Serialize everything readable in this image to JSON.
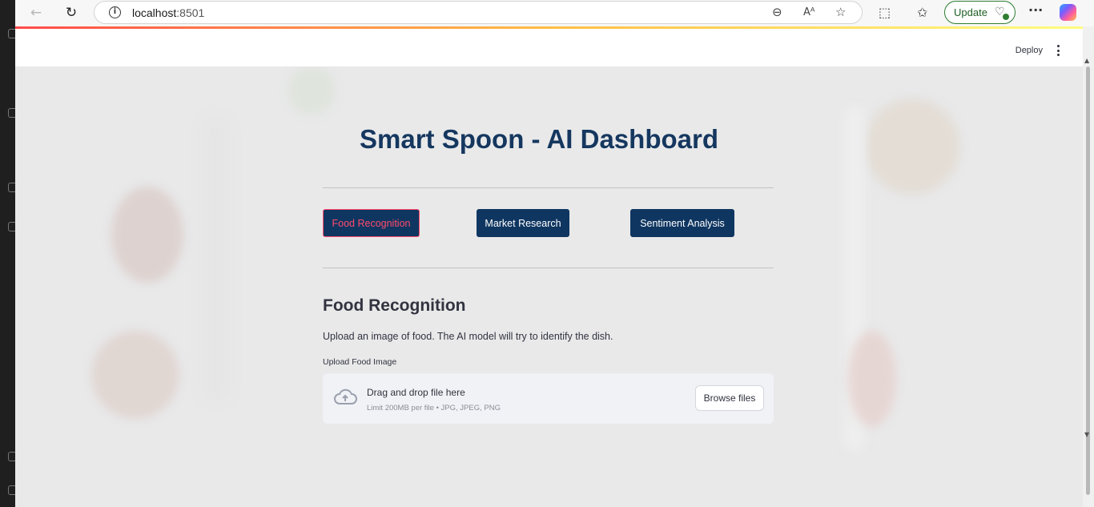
{
  "browser": {
    "url_host": "localhost",
    "url_port": ":8501",
    "update_label": "Update",
    "menu_label": "···"
  },
  "icons": {
    "back": "arrow-left-icon",
    "reload": "reload-icon",
    "info": "info-icon",
    "zoom": "zoom-out-icon",
    "read_aloud": "read-aloud-icon",
    "favorite": "star-icon",
    "extensions": "puzzle-icon",
    "favorites_list": "favorites-icon",
    "health": "heartbeat-icon",
    "copilot": "copilot-icon",
    "upload": "cloud-upload-icon"
  },
  "header": {
    "deploy_label": "Deploy"
  },
  "main": {
    "title": "Smart Spoon - AI Dashboard",
    "tabs": [
      {
        "label": "Food Recognition",
        "active": true
      },
      {
        "label": "Market Research",
        "active": false
      },
      {
        "label": "Sentiment Analysis",
        "active": false
      }
    ],
    "section_title": "Food Recognition",
    "description": "Upload an image of food. The AI model will try to identify the dish.",
    "uploader": {
      "label": "Upload Food Image",
      "drop_text": "Drag and drop file here",
      "limit_text": "Limit 200MB per file • JPG, JPEG, PNG",
      "browse_label": "Browse files"
    }
  },
  "colors": {
    "primary": "#0f3661",
    "accent": "#ff4b6b",
    "update_green": "#2f7d32"
  }
}
